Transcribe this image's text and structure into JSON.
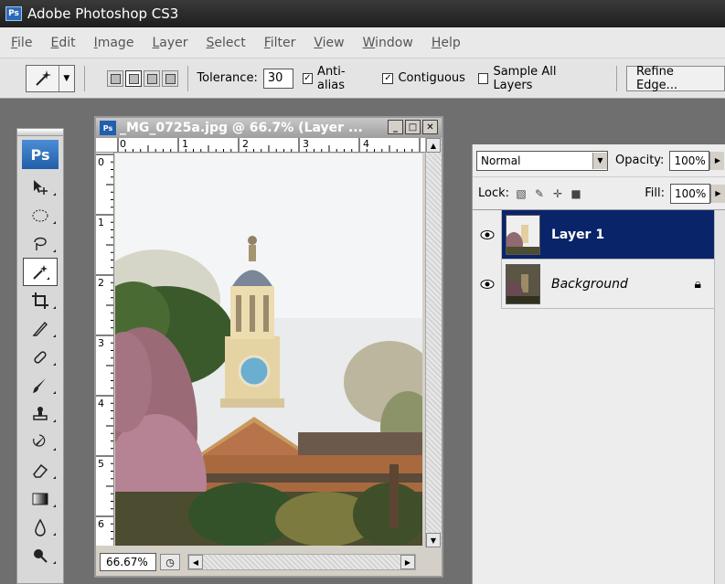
{
  "app": {
    "title": "Adobe Photoshop CS3",
    "logo": "Ps"
  },
  "menu": [
    "File",
    "Edit",
    "Image",
    "Layer",
    "Select",
    "Filter",
    "View",
    "Window",
    "Help"
  ],
  "options": {
    "tool_icon": "magic-wand-icon",
    "tolerance_label": "Tolerance:",
    "tolerance_value": "30",
    "anti_alias_label": "Anti-alias",
    "anti_alias_checked": true,
    "contiguous_label": "Contiguous",
    "contiguous_checked": true,
    "sample_all_label": "Sample All Layers",
    "sample_all_checked": false,
    "refine_edge_label": "Refine Edge..."
  },
  "toolbox": {
    "badge": "Ps",
    "tools": [
      "move-icon",
      "marquee-icon",
      "lasso-icon",
      "magic-wand-icon",
      "crop-icon",
      "slice-icon",
      "healing-icon",
      "brush-icon",
      "stamp-icon",
      "history-brush-icon",
      "eraser-icon",
      "gradient-icon",
      "blur-icon",
      "dodge-icon"
    ],
    "active_tool": "magic-wand-icon"
  },
  "document": {
    "title": "_MG_0725a.jpg @ 66.7% (Layer ...",
    "zoom": "66.67%",
    "ruler_h_labels": [
      "0",
      "1",
      "2",
      "3",
      "4"
    ],
    "ruler_v_labels": [
      "0",
      "1",
      "2",
      "3",
      "4",
      "5",
      "6"
    ]
  },
  "layers_panel": {
    "blend_mode": "Normal",
    "opacity_label": "Opacity:",
    "opacity_value": "100%",
    "lock_label": "Lock:",
    "fill_label": "Fill:",
    "fill_value": "100%",
    "layers": [
      {
        "name": "Layer 1",
        "selected": true,
        "visible": true
      },
      {
        "name": "Background",
        "selected": false,
        "visible": true,
        "locked": true
      }
    ]
  },
  "colors": {
    "selected_layer": "#0a246a",
    "workspace": "#6f6f6f"
  }
}
